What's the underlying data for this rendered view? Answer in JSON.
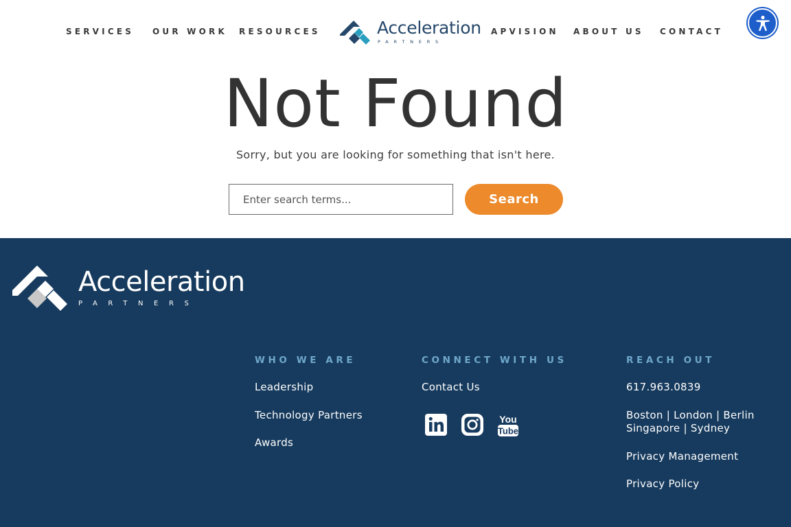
{
  "nav": {
    "services": "SERVICES",
    "our_work": "OUR WORK",
    "resources": "RESOURCES",
    "apvision": "APVISION",
    "about_us": "ABOUT US",
    "contact": "CONTACT"
  },
  "logo": {
    "name": "Acceleration",
    "sub": "PARTNERS",
    "primary_color": "#25476a",
    "accent_color": "#2a9fc0"
  },
  "accessibility": {
    "icon": "accessibility-person-icon",
    "color": "#1e5ecb"
  },
  "main": {
    "title": "Not Found",
    "subtitle": "Sorry, but you are looking for something that isn't here.",
    "search_placeholder": "Enter search terms...",
    "search_button": "Search",
    "button_color": "#ec8a2c"
  },
  "footer": {
    "background": "#173b5e",
    "heading_color": "#6fa8cc",
    "who_we_are": {
      "heading": "WHO WE ARE",
      "links": [
        "Leadership",
        "Technology Partners",
        "Awards"
      ]
    },
    "connect": {
      "heading": "CONNECT WITH US",
      "contact_link": "Contact Us",
      "social_icons": [
        "linkedin-icon",
        "instagram-icon",
        "youtube-icon"
      ],
      "youtube_you": "You",
      "youtube_tube": "Tube"
    },
    "reach_out": {
      "heading": "REACH OUT",
      "phone": "617.963.0839",
      "locations_line1": "Boston | London | Berlin",
      "locations_line2": "Singapore | Sydney",
      "privacy_management": "Privacy Management",
      "privacy_policy": "Privacy Policy"
    }
  }
}
